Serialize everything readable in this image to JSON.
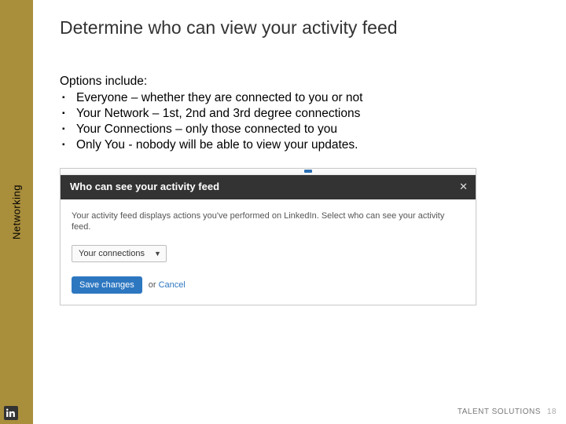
{
  "sidebar": {
    "label": "Networking"
  },
  "title": "Determine who can view your activity feed",
  "intro": "Options include:",
  "bullets": [
    "Everyone – whether they are connected to you or not",
    "Your Network – 1st, 2nd and 3rd degree connections",
    "Your Connections – only those connected to you",
    "Only You - nobody will be able to view your updates."
  ],
  "modal": {
    "header": "Who can see your activity feed",
    "close": "✕",
    "description": "Your activity feed displays actions you've performed on LinkedIn. Select who can see your activity feed.",
    "dropdown_value": "Your connections",
    "save": "Save changes",
    "cancel_prefix": "or ",
    "cancel": "Cancel"
  },
  "footer": {
    "brand": "TALENT SOLUTIONS",
    "page": "18"
  }
}
